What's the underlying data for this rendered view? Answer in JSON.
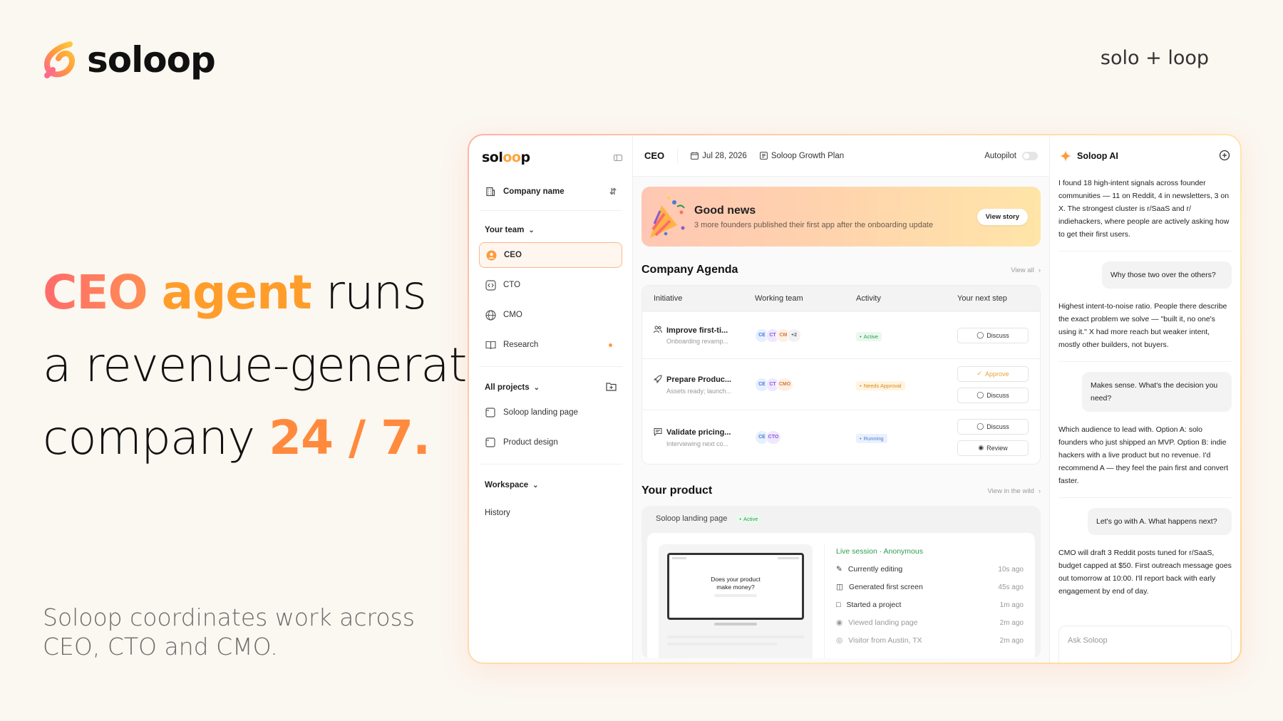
{
  "brand": {
    "name": "soloop",
    "tagline": "solo + loop"
  },
  "hero": {
    "line1_a": "CEO",
    "line1_b": "agent",
    "line1_c": "runs",
    "line2": "a revenue-generate",
    "line3_a": "company",
    "line3_b": "24 / 7.",
    "subline": "Soloop coordinates work across CEO, CTO and CMO."
  },
  "colors": {
    "accent": "#ff9d2b",
    "accent_pink": "#ff6b6b",
    "active_green": "#2f9c4f"
  },
  "sidebar": {
    "logo": "soloop",
    "company": "Company name",
    "team_label": "Your team",
    "team": [
      {
        "label": "CEO",
        "icon": "ceo-avatar-icon"
      },
      {
        "label": "CTO",
        "icon": "code-icon"
      },
      {
        "label": "CMO",
        "icon": "globe-icon"
      },
      {
        "label": "Research",
        "icon": "book-icon"
      }
    ],
    "projects_label": "All projects",
    "projects": [
      "Soloop landing page",
      "Product design"
    ],
    "workspace_label": "Workspace",
    "history": "History"
  },
  "topbar": {
    "title": "CEO",
    "date": "Jul 28, 2026",
    "plan": "Soloop Growth Plan",
    "autopilot": "Autopilot"
  },
  "banner": {
    "title": "Good news",
    "subtitle": "3 more founders published their first app after the onboarding update",
    "button": "View story"
  },
  "agenda": {
    "title": "Company Agenda",
    "link": "View all",
    "columns": [
      "Initiative",
      "Working team",
      "Activity",
      "Your next step"
    ],
    "rows": [
      {
        "title": "Improve first-ti...",
        "sub": "Onboarding revamp...",
        "team": [
          "CE",
          "CT",
          "CM",
          "+2"
        ],
        "status": "Active",
        "actions": [
          "Discuss"
        ]
      },
      {
        "title": "Prepare Produc...",
        "sub": "Assets ready; launch...",
        "team": [
          "CE",
          "CT",
          "CMO"
        ],
        "status": "Needs Approval",
        "actions": [
          "Approve",
          "Discuss"
        ]
      },
      {
        "title": "Validate pricing...",
        "sub": "Interviewing next co...",
        "team": [
          "CE",
          "CTO"
        ],
        "status": "Running",
        "actions": [
          "Discuss",
          "Review"
        ]
      }
    ]
  },
  "product": {
    "title": "Your product",
    "link": "View in the wild",
    "name": "Soloop landing page",
    "status": "Active",
    "preview_text": "Does your product make money?",
    "live": "Live session · Anonymous",
    "activity": [
      {
        "label": "Currently editing",
        "time": "10s ago"
      },
      {
        "label": "Generated first screen",
        "time": "45s ago"
      },
      {
        "label": "Started a project",
        "time": "1m ago"
      },
      {
        "label": "Viewed landing page",
        "time": "2m ago"
      },
      {
        "label": "Visitor from Austin, TX",
        "time": "2m ago"
      }
    ]
  },
  "chat": {
    "title": "Soloop AI",
    "messages": [
      {
        "role": "ai",
        "text": "I found 18 high-intent signals across founder communities — 11 on Reddit, 4 in newsletters, 3 on X. The strongest cluster is r/SaaS and r/ indiehackers, where people are actively asking how to get their first users."
      },
      {
        "role": "user",
        "text": "Why those two over the others?"
      },
      {
        "role": "ai",
        "text": "Highest intent-to-noise ratio. People there describe the exact problem we solve — \"built it, no one's using it.\" X had more reach but weaker intent, mostly other builders, not buyers."
      },
      {
        "role": "user",
        "text": "Makes sense. What's the decision you need?"
      },
      {
        "role": "ai",
        "text": "Which audience to lead with. Option A: solo founders who just shipped an MVP. Option B: indie hackers with a live product but no revenue. I'd recommend A — they feel the pain first and convert faster."
      },
      {
        "role": "user",
        "text": "Let's go with A. What happens next?"
      },
      {
        "role": "ai",
        "text": "CMO will draft 3 Reddit posts tuned for r/SaaS, budget capped at $50. First outreach message goes out tomorrow at 10:00. I'll report back with early engagement by end of day."
      }
    ],
    "input_placeholder": "Ask Soloop"
  }
}
